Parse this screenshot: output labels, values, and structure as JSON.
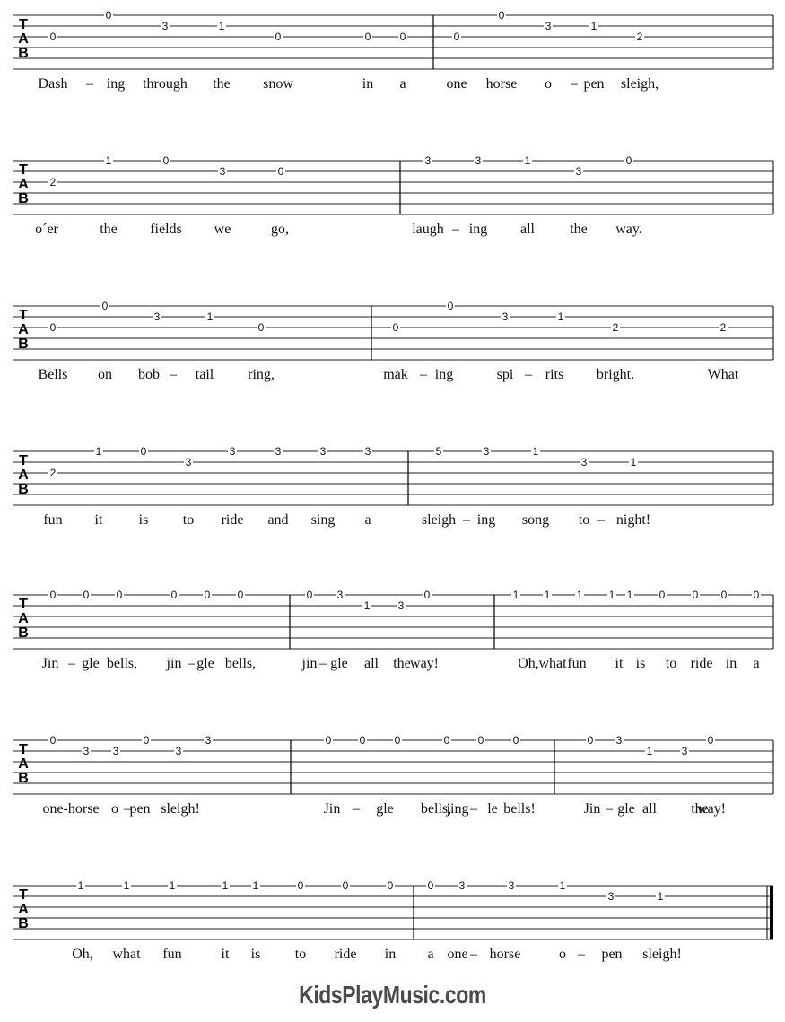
{
  "document": {
    "title_visible": "",
    "clef_label": [
      "T",
      "A",
      "B"
    ],
    "footer_text": "KidsPlayMusic.com"
  },
  "systems": [
    {
      "measures": [
        {
          "notes": [
            {
              "s": 2,
              "f": "0"
            },
            {
              "s": 0,
              "f": "0"
            },
            {
              "s": 1,
              "f": "3"
            },
            {
              "s": 1,
              "f": "1"
            },
            {
              "s": 2,
              "f": "0"
            },
            {
              "s": 2,
              "f": "0"
            },
            {
              "s": 2,
              "f": "0"
            }
          ]
        },
        {
          "notes": [
            {
              "s": 2,
              "f": "0"
            },
            {
              "s": 0,
              "f": "0"
            },
            {
              "s": 1,
              "f": "3"
            },
            {
              "s": 1,
              "f": "1"
            },
            {
              "s": 2,
              "f": "2"
            }
          ]
        }
      ],
      "lyrics": [
        "Dash",
        "–",
        "ing",
        "through",
        "the",
        "snow",
        "in",
        "a",
        "one",
        "horse",
        "o",
        "–",
        "pen",
        "sleigh,"
      ]
    },
    {
      "measures": [
        {
          "notes": [
            {
              "s": 2,
              "f": "2"
            },
            {
              "s": 0,
              "f": "1"
            },
            {
              "s": 0,
              "f": "0"
            },
            {
              "s": 1,
              "f": "3"
            },
            {
              "s": 1,
              "f": "0"
            }
          ]
        },
        {
          "notes": [
            {
              "s": 0,
              "f": "3"
            },
            {
              "s": 0,
              "f": "3"
            },
            {
              "s": 0,
              "f": "1"
            },
            {
              "s": 1,
              "f": "3"
            },
            {
              "s": 0,
              "f": "0"
            }
          ]
        }
      ],
      "lyrics": [
        "o´er",
        "the",
        "fields",
        "we",
        "go,",
        "laugh",
        "–",
        "ing",
        "all",
        "the",
        "way."
      ]
    },
    {
      "measures": [
        {
          "notes": [
            {
              "s": 2,
              "f": "0"
            },
            {
              "s": 0,
              "f": "0"
            },
            {
              "s": 1,
              "f": "3"
            },
            {
              "s": 1,
              "f": "1"
            },
            {
              "s": 2,
              "f": "0"
            }
          ]
        },
        {
          "notes": [
            {
              "s": 2,
              "f": "0"
            },
            {
              "s": 0,
              "f": "0"
            },
            {
              "s": 1,
              "f": "3"
            },
            {
              "s": 1,
              "f": "1"
            },
            {
              "s": 2,
              "f": "2"
            },
            {
              "s": 2,
              "f": "2"
            }
          ]
        }
      ],
      "lyrics": [
        "Bells",
        "on",
        "bob",
        "–",
        "tail",
        "ring,",
        "mak",
        "–",
        "ing",
        "spi",
        "–",
        "rits",
        "bright.",
        "What"
      ]
    },
    {
      "measures": [
        {
          "notes": [
            {
              "s": 2,
              "f": "2"
            },
            {
              "s": 0,
              "f": "1"
            },
            {
              "s": 0,
              "f": "0"
            },
            {
              "s": 1,
              "f": "3"
            },
            {
              "s": 0,
              "f": "3"
            },
            {
              "s": 0,
              "f": "3"
            },
            {
              "s": 0,
              "f": "3"
            },
            {
              "s": 0,
              "f": "3"
            }
          ]
        },
        {
          "notes": [
            {
              "s": 0,
              "f": "5"
            },
            {
              "s": 0,
              "f": "3"
            },
            {
              "s": 0,
              "f": "1"
            },
            {
              "s": 1,
              "f": "3"
            },
            {
              "s": 1,
              "f": "1"
            }
          ]
        }
      ],
      "lyrics": [
        "fun",
        "it",
        "is",
        "to",
        "ride",
        "and",
        "sing",
        "a",
        "sleigh",
        "–",
        "ing",
        "song",
        "to",
        "–",
        "night!"
      ]
    },
    {
      "measures": [
        {
          "notes": [
            {
              "s": 0,
              "f": "0"
            },
            {
              "s": 0,
              "f": "0"
            },
            {
              "s": 0,
              "f": "0"
            },
            {
              "s": 0,
              "f": "0"
            },
            {
              "s": 0,
              "f": "0"
            },
            {
              "s": 0,
              "f": "0"
            }
          ]
        },
        {
          "notes": [
            {
              "s": 0,
              "f": "0"
            },
            {
              "s": 0,
              "f": "3"
            },
            {
              "s": 1,
              "f": "1"
            },
            {
              "s": 1,
              "f": "3"
            },
            {
              "s": 0,
              "f": "0"
            }
          ]
        },
        {
          "notes": [
            {
              "s": 0,
              "f": "1"
            },
            {
              "s": 0,
              "f": "1"
            },
            {
              "s": 0,
              "f": "1"
            },
            {
              "s": 0,
              "f": "1"
            },
            {
              "s": 0,
              "f": "1"
            },
            {
              "s": 0,
              "f": "0"
            },
            {
              "s": 0,
              "f": "0"
            },
            {
              "s": 0,
              "f": "0"
            },
            {
              "s": 0,
              "f": "0"
            }
          ]
        }
      ],
      "lyrics": [
        "Jin",
        "–",
        "gle",
        "bells,",
        "jin",
        "–",
        "gle",
        "bells,",
        "jin",
        "–",
        "gle",
        "all",
        "the",
        "way!",
        "Oh,",
        "what",
        "fun",
        "it",
        "is",
        "to",
        "ride",
        "in",
        "a"
      ]
    },
    {
      "measures": [
        {
          "notes": [
            {
              "s": 0,
              "f": "0"
            },
            {
              "s": 1,
              "f": "3"
            },
            {
              "s": 1,
              "f": "3"
            },
            {
              "s": 0,
              "f": "0"
            },
            {
              "s": 1,
              "f": "3"
            },
            {
              "s": 0,
              "f": "3"
            }
          ]
        },
        {
          "notes": [
            {
              "s": 0,
              "f": "0"
            },
            {
              "s": 0,
              "f": "0"
            },
            {
              "s": 0,
              "f": "0"
            },
            {
              "s": 0,
              "f": "0"
            },
            {
              "s": 0,
              "f": "0"
            },
            {
              "s": 0,
              "f": "0"
            }
          ]
        },
        {
          "notes": [
            {
              "s": 0,
              "f": "0"
            },
            {
              "s": 0,
              "f": "3"
            },
            {
              "s": 1,
              "f": "1"
            },
            {
              "s": 1,
              "f": "3"
            },
            {
              "s": 0,
              "f": "0"
            }
          ]
        }
      ],
      "lyrics": [
        "one-horse",
        "o",
        "–",
        "pen",
        "sleigh!",
        "Jin",
        "–",
        "gle",
        "bells,",
        "jing",
        "–",
        "le",
        "bells!",
        "Jin",
        "–",
        "gle",
        "all",
        "the",
        "way!"
      ]
    },
    {
      "measures": [
        {
          "notes": [
            {
              "s": 0,
              "f": "1"
            },
            {
              "s": 0,
              "f": "1"
            },
            {
              "s": 0,
              "f": "1"
            },
            {
              "s": 0,
              "f": "1"
            },
            {
              "s": 0,
              "f": "1"
            },
            {
              "s": 0,
              "f": "0"
            },
            {
              "s": 0,
              "f": "0"
            },
            {
              "s": 0,
              "f": "0"
            }
          ]
        },
        {
          "notes": [
            {
              "s": 0,
              "f": "0"
            },
            {
              "s": 0,
              "f": "3"
            },
            {
              "s": 0,
              "f": "3"
            },
            {
              "s": 0,
              "f": "1"
            },
            {
              "s": 1,
              "f": "3"
            },
            {
              "s": 1,
              "f": "1"
            }
          ]
        }
      ],
      "lyrics": [
        "Oh,",
        "what",
        "fun",
        "it",
        "is",
        "to",
        "ride",
        "in",
        "a",
        "one",
        "–",
        "horse",
        "o",
        "–",
        "pen",
        "sleigh!"
      ],
      "final_barline": true
    }
  ]
}
